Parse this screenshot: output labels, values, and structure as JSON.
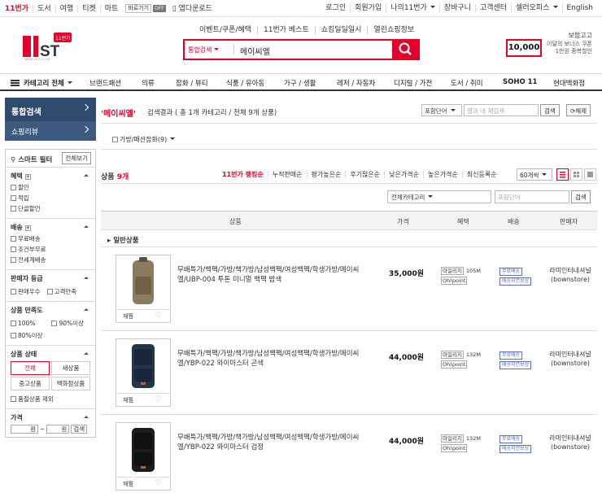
{
  "topbar": {
    "left": [
      "11번가",
      "도서",
      "여행",
      "티켓",
      "마트"
    ],
    "quick_label": "바로가기",
    "quick_state": "OFF",
    "app_download": "앱다운로드",
    "right": [
      "로그인",
      "회원가입",
      "나의11번가",
      "장바구니",
      "고객센터",
      "셀러오피스",
      "English"
    ]
  },
  "header": {
    "logo_text": "11ST",
    "logo_badge": "11번가",
    "links": [
      "이벤트/쿠폰/혜택",
      "11번가 베스트",
      "쇼킹딜딜일시",
      "열린쇼핑정보"
    ],
    "search_category": "통합검색",
    "search_query": "메이씨엘",
    "promo_title": "보험고고",
    "promo_amount": "10,000",
    "promo_line1": "이달의 보너스 쿠폰",
    "promo_line2": "1만원 중복할인"
  },
  "nav": {
    "all_label": "카테고리 전체",
    "items": [
      "브랜드패션",
      "의류",
      "잡화 / 뷰티",
      "식품 / 유아동",
      "가구 / 생활",
      "레저 / 자동차",
      "디지털 / 가전",
      "도서 / 취미",
      "SOHO 11",
      "현대백화점"
    ]
  },
  "sidebar": {
    "tab_total": "통합검색",
    "tab_review": "쇼핑리뷰",
    "smart_filter": "스마트 필터",
    "all_view": "전체보기",
    "groups": {
      "benefit": {
        "title": "혜택",
        "options": [
          "할인",
          "적립",
          "단골할인"
        ]
      },
      "delivery": {
        "title": "배송",
        "options": [
          "무료배송",
          "조건부무료",
          "전세계배송"
        ]
      },
      "seller_grade": {
        "title": "판매자 등급",
        "options": [
          "판매우수",
          "고객만족"
        ]
      },
      "satisfaction": {
        "title": "상품 만족도",
        "options": [
          "100%",
          "90%이상",
          "80%이상"
        ]
      },
      "condition": {
        "title": "상품 상태",
        "options": [
          "전체",
          "새상품",
          "중고상품",
          "백화점상품"
        ],
        "exclude": "품절상품 제외"
      },
      "price": {
        "title": "가격",
        "unit1": "원",
        "tilde": "~",
        "unit2": "원",
        "go": "검색"
      }
    }
  },
  "results": {
    "keyword": "'메이씨엘'",
    "summary": "검색결과 ( 총 1개 카테고리 / 전체 9개 상품)",
    "scope_select": "포함단어",
    "scope_placeholder": "결과 내 재검색",
    "search_btn": "검색",
    "reset_btn": "⟳해제",
    "category_filter": "가방/패션잡화(9)",
    "count_label": "상품",
    "count_value": "9개",
    "sort_tabs": [
      "11번가 랭킹순",
      "누적판매순",
      "평가높은순",
      "후기많은순",
      "낮은가격순",
      "높은가격순",
      "최신등록순"
    ],
    "per_page": "60개씩",
    "cat_select": "전체카테고리",
    "cat_placeholder": "포함단어",
    "cat_btn": "검색",
    "columns": [
      "상품",
      "가격",
      "혜택",
      "배송",
      "판매자"
    ],
    "section": "일반상품"
  },
  "products": [
    {
      "name": "무배특가/백팩/가방/책가방/남성백팩/여성백팩/학생가방/메이씨엘/UBP-004 투톤 미니멀 백팩 밤색",
      "price": "35,000원",
      "mileage": "105M",
      "ohpoint": "Oh!point",
      "ship1": "무료배송",
      "ship2": "배송지연보상",
      "seller1": "라미인터내셔널",
      "seller2": "(bownstore)",
      "wish": "재찜",
      "color": "#8a7a5e"
    },
    {
      "name": "무배특가/백팩/가방/책가방/남성백팩/여성백팩/학생가방/메이씨엘/YBP-022 와이마스터 곤색",
      "price": "44,000원",
      "mileage": "132M",
      "ohpoint": "Oh!point",
      "ship1": "무료배송",
      "ship2": "배송지연보상",
      "seller1": "라미인터내셔널",
      "seller2": "(bownstore)",
      "wish": "재찜",
      "color": "#23344d"
    },
    {
      "name": "무배특가/백팩/가방/책가방/남성백팩/여성백팩/학생가방/메이씨엘/YBP-022 와이마스터 검정",
      "price": "44,000원",
      "mileage": "132M",
      "ohpoint": "Oh!point",
      "ship1": "무료배송",
      "ship2": "배송지연보상",
      "seller1": "라미인터내셔널",
      "seller2": "(bownstore)",
      "wish": "재찜",
      "color": "#1c1c1c"
    }
  ],
  "mileage_label": "마일리지"
}
